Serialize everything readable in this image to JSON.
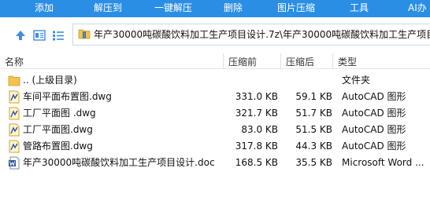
{
  "toolbar": {
    "add": "添加",
    "extract_to": "解压到",
    "one_click_extract": "一键解压",
    "delete": "删除",
    "image_compress": "图片压缩",
    "tools": "工具",
    "ai": "AI办"
  },
  "address": {
    "path": "年产30000吨碳酸饮料加工生产项目设计.7z\\年产30000吨碳酸饮料加工生产项目"
  },
  "columns": {
    "name": "名称",
    "size_before": "压缩前",
    "size_after": "压缩后",
    "type": "类型"
  },
  "files": [
    {
      "name": ".. (上级目录)",
      "before": "",
      "after": "",
      "type": "文件夹",
      "icon": "folder-icon"
    },
    {
      "name": "车间平面布置图.dwg",
      "before": "331.0 KB",
      "after": "59.1 KB",
      "type": "AutoCAD 图形",
      "icon": "dwg-file-icon"
    },
    {
      "name": "工厂平面图 .dwg",
      "before": "321.7 KB",
      "after": "51.7 KB",
      "type": "AutoCAD 图形",
      "icon": "dwg-file-icon"
    },
    {
      "name": "工厂平面图.dwg",
      "before": "83.0 KB",
      "after": "51.5 KB",
      "type": "AutoCAD 图形",
      "icon": "dwg-file-icon"
    },
    {
      "name": "管路布置图.dwg",
      "before": "317.8 KB",
      "after": "44.3 KB",
      "type": "AutoCAD 图形",
      "icon": "dwg-file-icon"
    },
    {
      "name": "年产30000吨碳酸饮料加工生产项目设计.doc",
      "before": "168.5 KB",
      "after": "35.5 KB",
      "type": "Microsoft Word ...",
      "icon": "word-doc-icon"
    }
  ],
  "colors": {
    "toolbar_bg": "#2a8ee4",
    "folder": "#f2c24a",
    "dwg": "#d9a21c",
    "word": "#2b5797"
  }
}
